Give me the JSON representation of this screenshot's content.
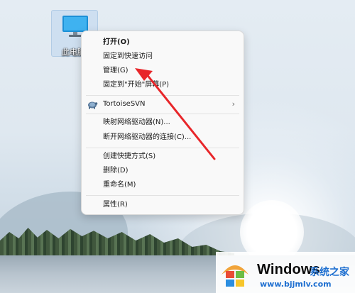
{
  "desktop": {
    "icon_label": "此电脑"
  },
  "context_menu": {
    "items": [
      {
        "label": "打开(O)",
        "bold": true
      },
      {
        "label": "固定到快速访问"
      },
      {
        "label": "管理(G)"
      },
      {
        "label": "固定到\"开始\"屏幕(P)"
      },
      {
        "label": "TortoiseSVN",
        "has_submenu": true,
        "icon": "tortoisesvn-icon"
      },
      {
        "label": "映射网络驱动器(N)..."
      },
      {
        "label": "断开网络驱动器的连接(C)..."
      },
      {
        "label": "创建快捷方式(S)"
      },
      {
        "label": "删除(D)"
      },
      {
        "label": "重命名(M)"
      },
      {
        "label": "属性(R)"
      }
    ]
  },
  "watermark": {
    "brand": "Windows",
    "site": "系统之家",
    "url": "www.bjjmlv.com"
  },
  "colors": {
    "annotation_arrow": "#e8262a",
    "menu_bg": "#f9f9f9",
    "link_blue": "#1e6fd0"
  }
}
